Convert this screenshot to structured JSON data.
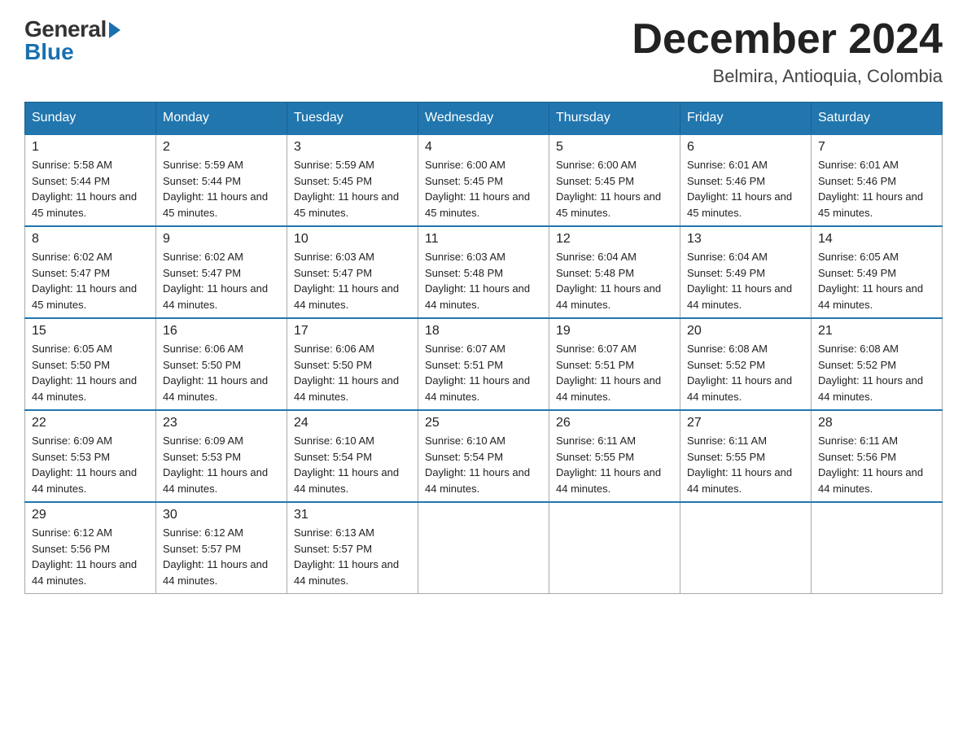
{
  "logo": {
    "general": "General",
    "blue": "Blue"
  },
  "header": {
    "month_year": "December 2024",
    "location": "Belmira, Antioquia, Colombia"
  },
  "weekdays": [
    "Sunday",
    "Monday",
    "Tuesday",
    "Wednesday",
    "Thursday",
    "Friday",
    "Saturday"
  ],
  "weeks": [
    [
      {
        "day": "1",
        "sunrise": "5:58 AM",
        "sunset": "5:44 PM",
        "daylight": "11 hours and 45 minutes."
      },
      {
        "day": "2",
        "sunrise": "5:59 AM",
        "sunset": "5:44 PM",
        "daylight": "11 hours and 45 minutes."
      },
      {
        "day": "3",
        "sunrise": "5:59 AM",
        "sunset": "5:45 PM",
        "daylight": "11 hours and 45 minutes."
      },
      {
        "day": "4",
        "sunrise": "6:00 AM",
        "sunset": "5:45 PM",
        "daylight": "11 hours and 45 minutes."
      },
      {
        "day": "5",
        "sunrise": "6:00 AM",
        "sunset": "5:45 PM",
        "daylight": "11 hours and 45 minutes."
      },
      {
        "day": "6",
        "sunrise": "6:01 AM",
        "sunset": "5:46 PM",
        "daylight": "11 hours and 45 minutes."
      },
      {
        "day": "7",
        "sunrise": "6:01 AM",
        "sunset": "5:46 PM",
        "daylight": "11 hours and 45 minutes."
      }
    ],
    [
      {
        "day": "8",
        "sunrise": "6:02 AM",
        "sunset": "5:47 PM",
        "daylight": "11 hours and 45 minutes."
      },
      {
        "day": "9",
        "sunrise": "6:02 AM",
        "sunset": "5:47 PM",
        "daylight": "11 hours and 44 minutes."
      },
      {
        "day": "10",
        "sunrise": "6:03 AM",
        "sunset": "5:47 PM",
        "daylight": "11 hours and 44 minutes."
      },
      {
        "day": "11",
        "sunrise": "6:03 AM",
        "sunset": "5:48 PM",
        "daylight": "11 hours and 44 minutes."
      },
      {
        "day": "12",
        "sunrise": "6:04 AM",
        "sunset": "5:48 PM",
        "daylight": "11 hours and 44 minutes."
      },
      {
        "day": "13",
        "sunrise": "6:04 AM",
        "sunset": "5:49 PM",
        "daylight": "11 hours and 44 minutes."
      },
      {
        "day": "14",
        "sunrise": "6:05 AM",
        "sunset": "5:49 PM",
        "daylight": "11 hours and 44 minutes."
      }
    ],
    [
      {
        "day": "15",
        "sunrise": "6:05 AM",
        "sunset": "5:50 PM",
        "daylight": "11 hours and 44 minutes."
      },
      {
        "day": "16",
        "sunrise": "6:06 AM",
        "sunset": "5:50 PM",
        "daylight": "11 hours and 44 minutes."
      },
      {
        "day": "17",
        "sunrise": "6:06 AM",
        "sunset": "5:50 PM",
        "daylight": "11 hours and 44 minutes."
      },
      {
        "day": "18",
        "sunrise": "6:07 AM",
        "sunset": "5:51 PM",
        "daylight": "11 hours and 44 minutes."
      },
      {
        "day": "19",
        "sunrise": "6:07 AM",
        "sunset": "5:51 PM",
        "daylight": "11 hours and 44 minutes."
      },
      {
        "day": "20",
        "sunrise": "6:08 AM",
        "sunset": "5:52 PM",
        "daylight": "11 hours and 44 minutes."
      },
      {
        "day": "21",
        "sunrise": "6:08 AM",
        "sunset": "5:52 PM",
        "daylight": "11 hours and 44 minutes."
      }
    ],
    [
      {
        "day": "22",
        "sunrise": "6:09 AM",
        "sunset": "5:53 PM",
        "daylight": "11 hours and 44 minutes."
      },
      {
        "day": "23",
        "sunrise": "6:09 AM",
        "sunset": "5:53 PM",
        "daylight": "11 hours and 44 minutes."
      },
      {
        "day": "24",
        "sunrise": "6:10 AM",
        "sunset": "5:54 PM",
        "daylight": "11 hours and 44 minutes."
      },
      {
        "day": "25",
        "sunrise": "6:10 AM",
        "sunset": "5:54 PM",
        "daylight": "11 hours and 44 minutes."
      },
      {
        "day": "26",
        "sunrise": "6:11 AM",
        "sunset": "5:55 PM",
        "daylight": "11 hours and 44 minutes."
      },
      {
        "day": "27",
        "sunrise": "6:11 AM",
        "sunset": "5:55 PM",
        "daylight": "11 hours and 44 minutes."
      },
      {
        "day": "28",
        "sunrise": "6:11 AM",
        "sunset": "5:56 PM",
        "daylight": "11 hours and 44 minutes."
      }
    ],
    [
      {
        "day": "29",
        "sunrise": "6:12 AM",
        "sunset": "5:56 PM",
        "daylight": "11 hours and 44 minutes."
      },
      {
        "day": "30",
        "sunrise": "6:12 AM",
        "sunset": "5:57 PM",
        "daylight": "11 hours and 44 minutes."
      },
      {
        "day": "31",
        "sunrise": "6:13 AM",
        "sunset": "5:57 PM",
        "daylight": "11 hours and 44 minutes."
      },
      null,
      null,
      null,
      null
    ]
  ],
  "labels": {
    "sunrise": "Sunrise:",
    "sunset": "Sunset:",
    "daylight": "Daylight:"
  }
}
